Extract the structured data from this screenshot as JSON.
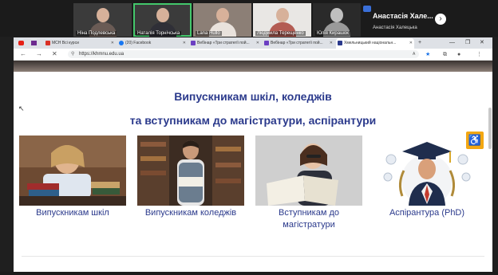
{
  "meeting": {
    "participants": [
      {
        "name": "Ніна Подлевська"
      },
      {
        "name": "Наталія Торнічська"
      },
      {
        "name": "Lana Hullo"
      },
      {
        "name": "Людмила Терещенко"
      },
      {
        "name": "Юлія Кирашок"
      }
    ],
    "featured_name": "Анастасія Хале...",
    "featured_subname": "Анастасія Халецька"
  },
  "browser": {
    "tabs": [
      {
        "label": "МСН Всі курси",
        "color": "#d93025"
      },
      {
        "label": "(20) Facebook",
        "color": "#1877f2"
      },
      {
        "label": "Вебінар «Три стратегії пой...",
        "color": "#6c3fc2"
      },
      {
        "label": "Вебінар «Три стратегії пой...",
        "color": "#6c3fc2"
      },
      {
        "label": "Хмельницький національн...",
        "color": "#2b3a8c"
      }
    ],
    "url": "https://khmnu.edu.ua",
    "new_tab_symbol": "+"
  },
  "page": {
    "heading_line1": "Випускникам шкіл, коледжів",
    "heading_line2": "та вступникам до магістратури, аспірантури",
    "cards": [
      {
        "label": "Випускникам шкіл"
      },
      {
        "label": "Випускникам коледжів"
      },
      {
        "label": "Вступникам до магістратури"
      },
      {
        "label": "Аспірантура (PhD)"
      }
    ]
  },
  "colors": {
    "accent": "#2b3a8c",
    "accessibility": "#f3a712"
  }
}
